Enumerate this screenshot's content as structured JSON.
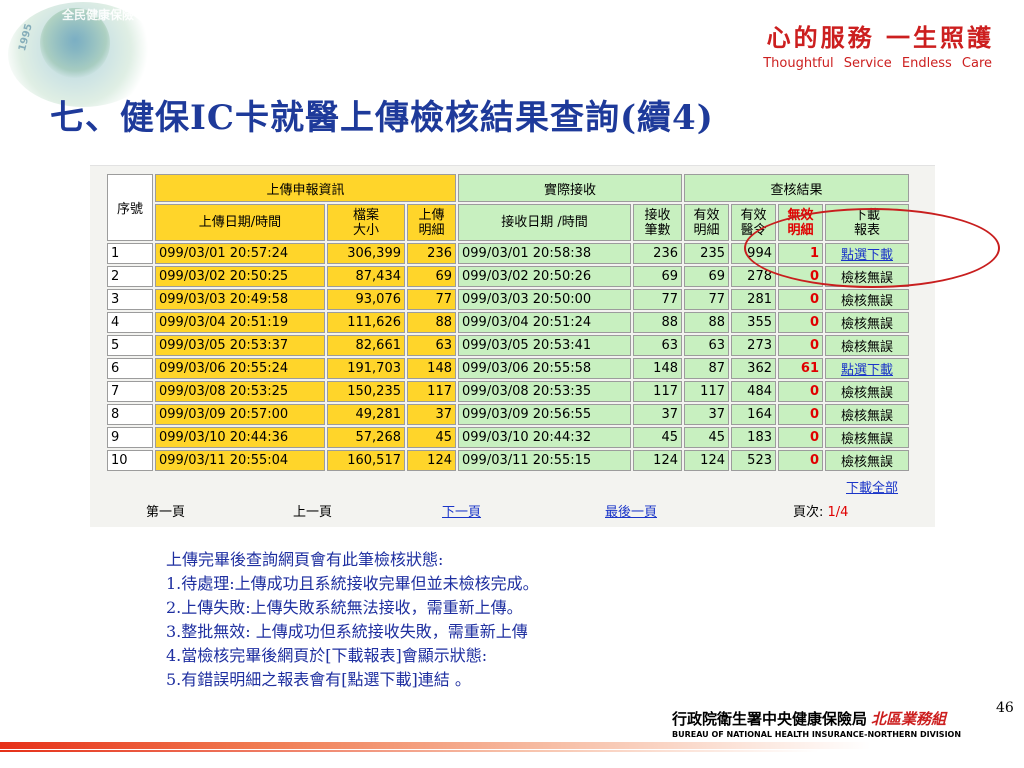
{
  "logo": {
    "text": "全民健康保險",
    "year": "1995"
  },
  "slogan": {
    "chinese": "心的服務 一生照護",
    "english": "Thoughtful Service Endless Care"
  },
  "title": "七、健保IC卡就醫上傳檢核結果查詢(續4)",
  "table": {
    "group_headers": [
      "序號",
      "上傳申報資訊",
      "實際接收",
      "查核結果"
    ],
    "columns": [
      "上傳日期/時間",
      "檔案大小",
      "上傳明細",
      "接收日期 /時間",
      "接收筆數",
      "有效明細",
      "有效醫令",
      "無效明細",
      "下載報表"
    ],
    "rows": [
      {
        "seq": "1",
        "upload_time": "099/03/01 20:57:24",
        "file_size": "306,399",
        "upload_count": "236",
        "receive_time": "099/03/01 20:58:38",
        "received": "236",
        "valid_detail": "235",
        "valid_order": "994",
        "invalid": "1",
        "report": "點選下載",
        "report_link": true
      },
      {
        "seq": "2",
        "upload_time": "099/03/02 20:50:25",
        "file_size": "87,434",
        "upload_count": "69",
        "receive_time": "099/03/02 20:50:26",
        "received": "69",
        "valid_detail": "69",
        "valid_order": "278",
        "invalid": "0",
        "report": "檢核無誤",
        "report_link": false
      },
      {
        "seq": "3",
        "upload_time": "099/03/03 20:49:58",
        "file_size": "93,076",
        "upload_count": "77",
        "receive_time": "099/03/03 20:50:00",
        "received": "77",
        "valid_detail": "77",
        "valid_order": "281",
        "invalid": "0",
        "report": "檢核無誤",
        "report_link": false
      },
      {
        "seq": "4",
        "upload_time": "099/03/04 20:51:19",
        "file_size": "111,626",
        "upload_count": "88",
        "receive_time": "099/03/04 20:51:24",
        "received": "88",
        "valid_detail": "88",
        "valid_order": "355",
        "invalid": "0",
        "report": "檢核無誤",
        "report_link": false
      },
      {
        "seq": "5",
        "upload_time": "099/03/05 20:53:37",
        "file_size": "82,661",
        "upload_count": "63",
        "receive_time": "099/03/05 20:53:41",
        "received": "63",
        "valid_detail": "63",
        "valid_order": "273",
        "invalid": "0",
        "report": "檢核無誤",
        "report_link": false
      },
      {
        "seq": "6",
        "upload_time": "099/03/06 20:55:24",
        "file_size": "191,703",
        "upload_count": "148",
        "receive_time": "099/03/06 20:55:58",
        "received": "148",
        "valid_detail": "87",
        "valid_order": "362",
        "invalid": "61",
        "report": "點選下載",
        "report_link": true
      },
      {
        "seq": "7",
        "upload_time": "099/03/08 20:53:25",
        "file_size": "150,235",
        "upload_count": "117",
        "receive_time": "099/03/08 20:53:35",
        "received": "117",
        "valid_detail": "117",
        "valid_order": "484",
        "invalid": "0",
        "report": "檢核無誤",
        "report_link": false
      },
      {
        "seq": "8",
        "upload_time": "099/03/09 20:57:00",
        "file_size": "49,281",
        "upload_count": "37",
        "receive_time": "099/03/09 20:56:55",
        "received": "37",
        "valid_detail": "37",
        "valid_order": "164",
        "invalid": "0",
        "report": "檢核無誤",
        "report_link": false
      },
      {
        "seq": "9",
        "upload_time": "099/03/10 20:44:36",
        "file_size": "57,268",
        "upload_count": "45",
        "receive_time": "099/03/10 20:44:32",
        "received": "45",
        "valid_detail": "45",
        "valid_order": "183",
        "invalid": "0",
        "report": "檢核無誤",
        "report_link": false
      },
      {
        "seq": "10",
        "upload_time": "099/03/11 20:55:04",
        "file_size": "160,517",
        "upload_count": "124",
        "receive_time": "099/03/11 20:55:15",
        "received": "124",
        "valid_detail": "124",
        "valid_order": "523",
        "invalid": "0",
        "report": "檢核無誤",
        "report_link": false
      }
    ],
    "download_all": "下載全部"
  },
  "pagination": {
    "first": "第一頁",
    "prev": "上一頁",
    "next": "下一頁",
    "last": "最後一頁",
    "page_label": "頁次:",
    "page_value": "1/4"
  },
  "notes": [
    "上傳完畢後查詢網頁會有此筆檢核狀態:",
    "1.待處理:上傳成功且系統接收完畢但並未檢核完成。",
    "2.上傳失敗:上傳失敗系統無法接收，需重新上傳。",
    "3.整批無效: 上傳成功但系統接收失敗，需重新上傳",
    "4.當檢核完畢後網頁於[下載報表]會顯示狀態:",
    "5.有錯誤明細之報表會有[點選下載]連結 。"
  ],
  "footer": {
    "org_name": "行政院衛生署中央健康保險局",
    "division": "北區業務組",
    "english": "BUREAU OF NATIONAL HEALTH INSURANCE-NORTHERN DIVISION",
    "page_number": "46"
  },
  "colors": {
    "title_blue": "#1e3a9a",
    "slogan_red": "#cc1f1f",
    "upload_yellow": "#ffd52a",
    "receive_green": "#c8f0c0",
    "link_blue": "#1a35c8",
    "invalid_red": "#e00000"
  }
}
